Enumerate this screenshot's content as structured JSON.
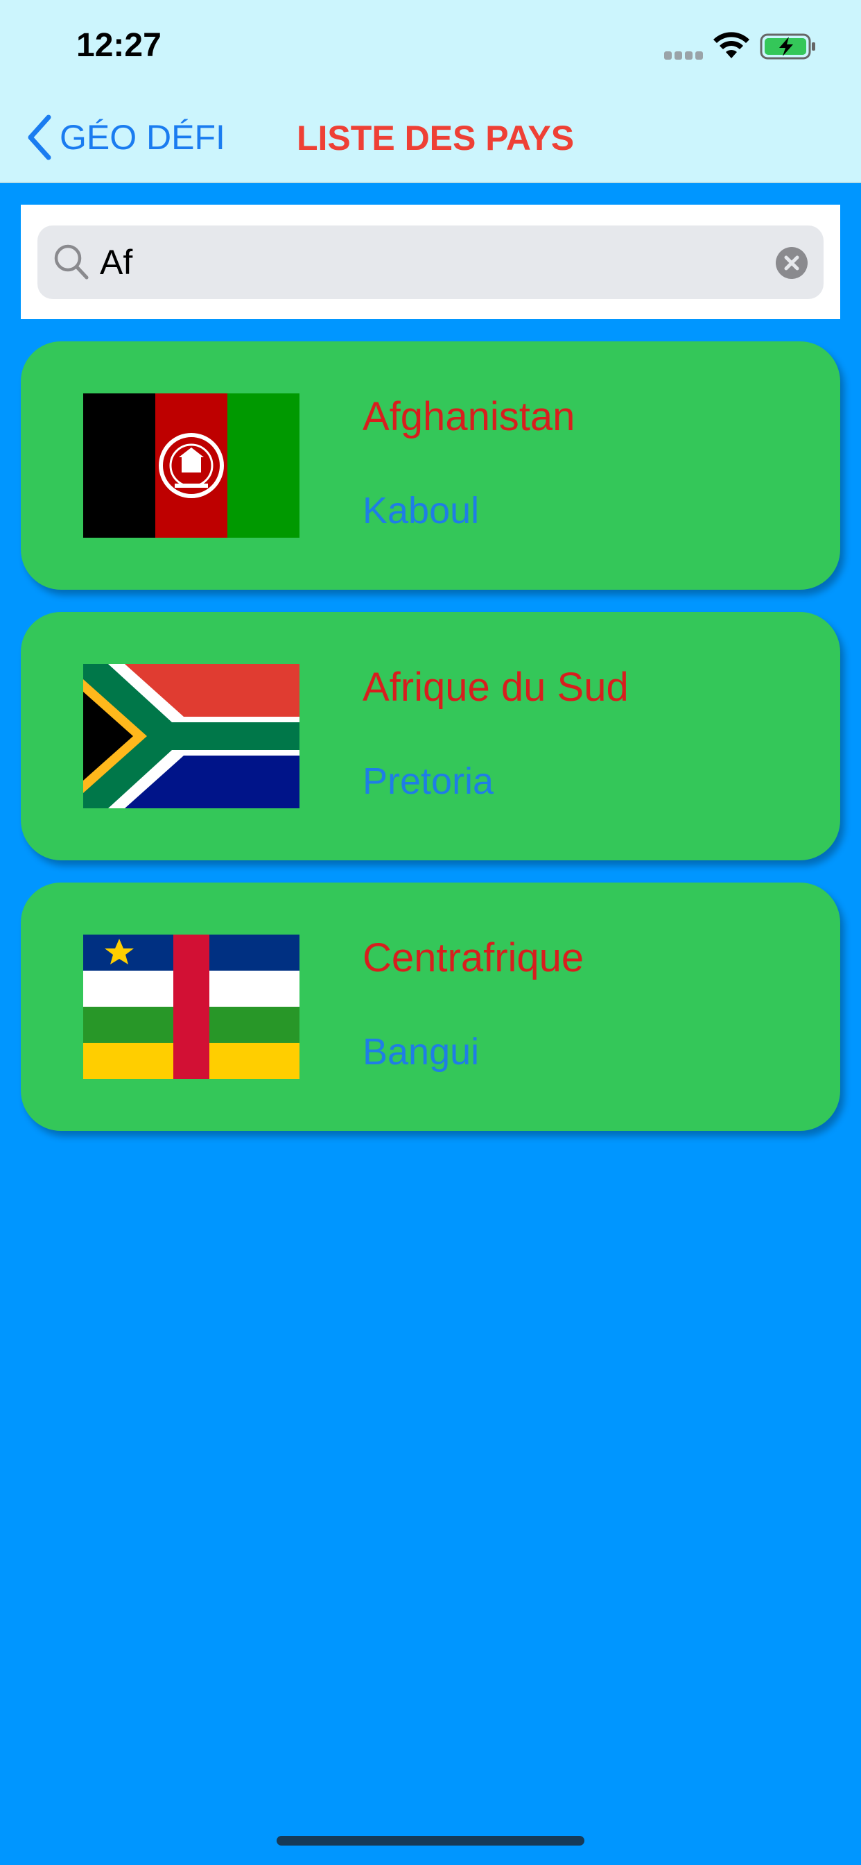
{
  "status_bar": {
    "time": "12:27"
  },
  "nav": {
    "back_label": "GÉO DÉFI",
    "title": "LISTE DES PAYS"
  },
  "search": {
    "value": "Af",
    "placeholder": ""
  },
  "countries": [
    {
      "name": "Afghanistan",
      "capital": "Kaboul",
      "flag_icon": "afghanistan-flag-icon"
    },
    {
      "name": "Afrique du Sud",
      "capital": "Pretoria",
      "flag_icon": "south-africa-flag-icon"
    },
    {
      "name": "Centrafrique",
      "capital": "Bangui",
      "flag_icon": "central-african-republic-flag-icon"
    }
  ],
  "colors": {
    "background": "#0096FF",
    "header": "#CCF5FD",
    "card": "#34C759",
    "country_name": "#D81E1E",
    "capital": "#1F7DE6",
    "nav_title": "#EE4035",
    "back": "#1A7CF0"
  },
  "icons": {
    "back": "chevron-left-icon",
    "search": "search-icon",
    "clear": "clear-icon",
    "wifi": "wifi-icon",
    "battery": "battery-charging-icon"
  }
}
